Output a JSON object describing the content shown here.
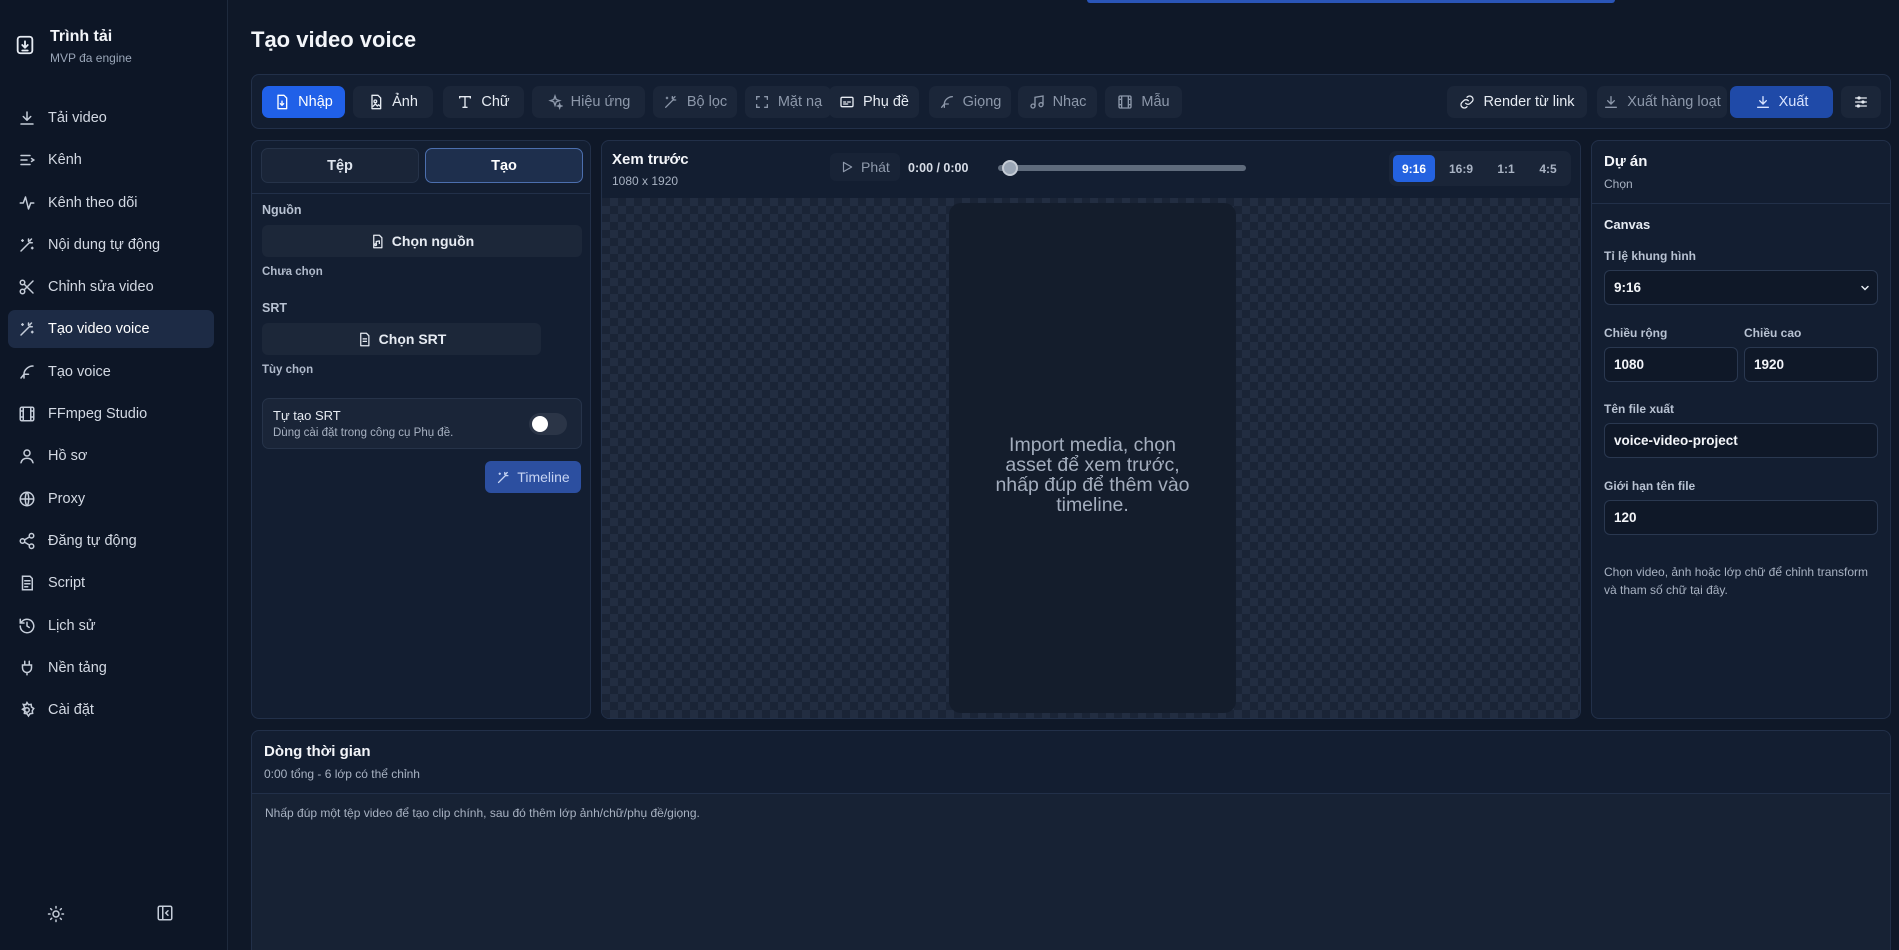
{
  "sidebar": {
    "brand_title": "Trình tải",
    "brand_subtitle": "MVP đa engine",
    "items": [
      {
        "label": "Tải video",
        "icon": "download-icon"
      },
      {
        "label": "Kênh",
        "icon": "list-icon"
      },
      {
        "label": "Kênh theo dõi",
        "icon": "activity-icon"
      },
      {
        "label": "Nội dung tự động",
        "icon": "magic-wand-icon"
      },
      {
        "label": "Chỉnh sửa video",
        "icon": "scissors-icon"
      },
      {
        "label": "Tạo video voice",
        "icon": "magic-wand-icon",
        "active": true
      },
      {
        "label": "Tạo voice",
        "icon": "feather-icon"
      },
      {
        "label": "FFmpeg Studio",
        "icon": "film-icon"
      },
      {
        "label": "Hồ sơ",
        "icon": "user-icon"
      },
      {
        "label": "Proxy",
        "icon": "globe-icon"
      },
      {
        "label": "Đăng tự động",
        "icon": "share-icon"
      },
      {
        "label": "Script",
        "icon": "script-icon"
      },
      {
        "label": "Lịch sử",
        "icon": "history-icon"
      },
      {
        "label": "Nền tảng",
        "icon": "plug-icon"
      },
      {
        "label": "Cài đặt",
        "icon": "gear-icon"
      }
    ]
  },
  "page": {
    "title": "Tạo video voice"
  },
  "toolbar": {
    "import": "Nhập",
    "image": "Ảnh",
    "text": "Chữ",
    "effects": "Hiệu ứng",
    "filters": "Bộ lọc",
    "mask": "Mặt nạ",
    "subtitles": "Phụ đề",
    "voice": "Giọng",
    "music": "Nhạc",
    "template": "Mẫu",
    "render_link": "Render từ link",
    "batch_export": "Xuất hàng loạt",
    "export": "Xuất"
  },
  "left_panel": {
    "tab_file": "Tệp",
    "tab_create": "Tạo",
    "source_label": "Nguồn",
    "choose_source": "Chọn nguồn",
    "not_selected": "Chưa chọn",
    "srt_label": "SRT",
    "choose_srt": "Chọn SRT",
    "options_label": "Tùy chọn",
    "auto_srt_title": "Tự tạo SRT",
    "auto_srt_desc": "Dùng cài đặt trong công cụ Phụ đề.",
    "auto_srt_enabled": false,
    "timeline_button": "Timeline"
  },
  "preview": {
    "title": "Xem trước",
    "resolution": "1080 x 1920",
    "play": "Phát",
    "time": "0:00 / 0:00",
    "progress": 0,
    "ratios": [
      "9:16",
      "16:9",
      "1:1",
      "4:5"
    ],
    "active_ratio": "9:16",
    "placeholder": "Import media, chọn asset để xem trước, nhấp đúp để thêm vào timeline."
  },
  "right_panel": {
    "title": "Dự án",
    "subtitle": "Chọn",
    "section": "Canvas",
    "aspect_label": "Tỉ lệ khung hình",
    "aspect_value": "9:16",
    "width_label": "Chiều rộng",
    "width_value": "1080",
    "height_label": "Chiều cao",
    "height_value": "1920",
    "filename_label": "Tên file xuất",
    "filename_value": "voice-video-project",
    "limit_label": "Giới hạn tên file",
    "limit_value": "120",
    "help": "Chọn video, ảnh hoặc lớp chữ để chỉnh transform và tham số chữ tại đây."
  },
  "timeline": {
    "title": "Dòng thời gian",
    "subtitle": "0:00 tổng - 6 lớp có thể chỉnh",
    "hint": "Nhấp đúp một tệp video để tạo clip chính, sau đó thêm lớp ảnh/chữ/phụ đề/giọng."
  },
  "colors": {
    "accent": "#2060e8",
    "background": "#0f1828",
    "panel": "#131e31"
  }
}
